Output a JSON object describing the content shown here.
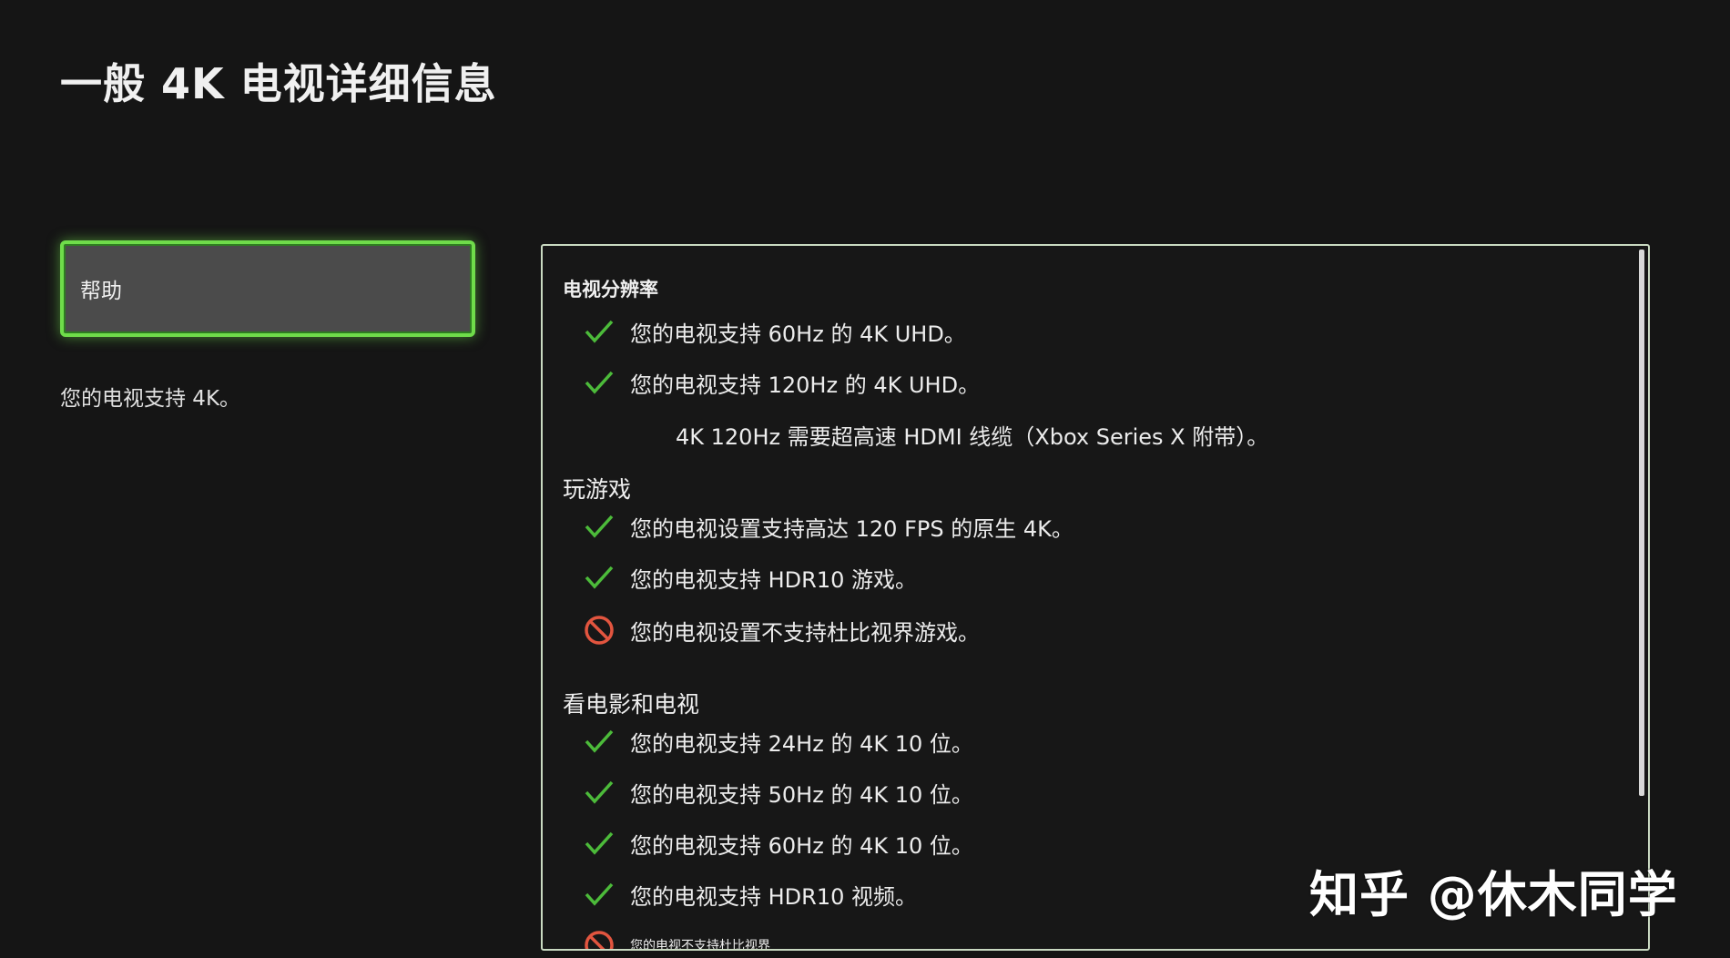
{
  "page": {
    "title": "一般 4K 电视详细信息"
  },
  "sidebar": {
    "help_label": "帮助",
    "description": "您的电视支持 4K。"
  },
  "details": {
    "resolution": {
      "heading": "电视分辨率",
      "items": [
        {
          "icon": "checkmark-icon",
          "text": "您的电视支持 60Hz 的 4K UHD。"
        },
        {
          "icon": "checkmark-icon",
          "text": "您的电视支持 120Hz 的 4K UHD。"
        }
      ],
      "note": "4K 120Hz 需要超高速 HDMI 线缆（Xbox Series X 附带）。"
    },
    "gaming": {
      "heading": "玩游戏",
      "items": [
        {
          "icon": "checkmark-icon",
          "text": "您的电视设置支持高达 120 FPS 的原生 4K。"
        },
        {
          "icon": "checkmark-icon",
          "text": "您的电视支持 HDR10 游戏。"
        },
        {
          "icon": "prohibited-icon",
          "text": "您的电视设置不支持杜比视界游戏。"
        }
      ]
    },
    "movies_tv": {
      "heading": "看电影和电视",
      "items": [
        {
          "icon": "checkmark-icon",
          "text": "您的电视支持 24Hz 的 4K 10 位。"
        },
        {
          "icon": "checkmark-icon",
          "text": "您的电视支持 50Hz 的 4K 10 位。"
        },
        {
          "icon": "checkmark-icon",
          "text": "您的电视支持 60Hz 的 4K 10 位。"
        },
        {
          "icon": "checkmark-icon",
          "text": "您的电视支持 HDR10 视频。"
        },
        {
          "icon": "prohibited-icon",
          "text": "您的电视不支持杜比视界"
        }
      ]
    }
  },
  "watermark": {
    "text": "知乎 @休木同学"
  },
  "colors": {
    "check": "#4cbb3a",
    "prohibited": "#e2553f",
    "focus": "#6fdc4a"
  }
}
